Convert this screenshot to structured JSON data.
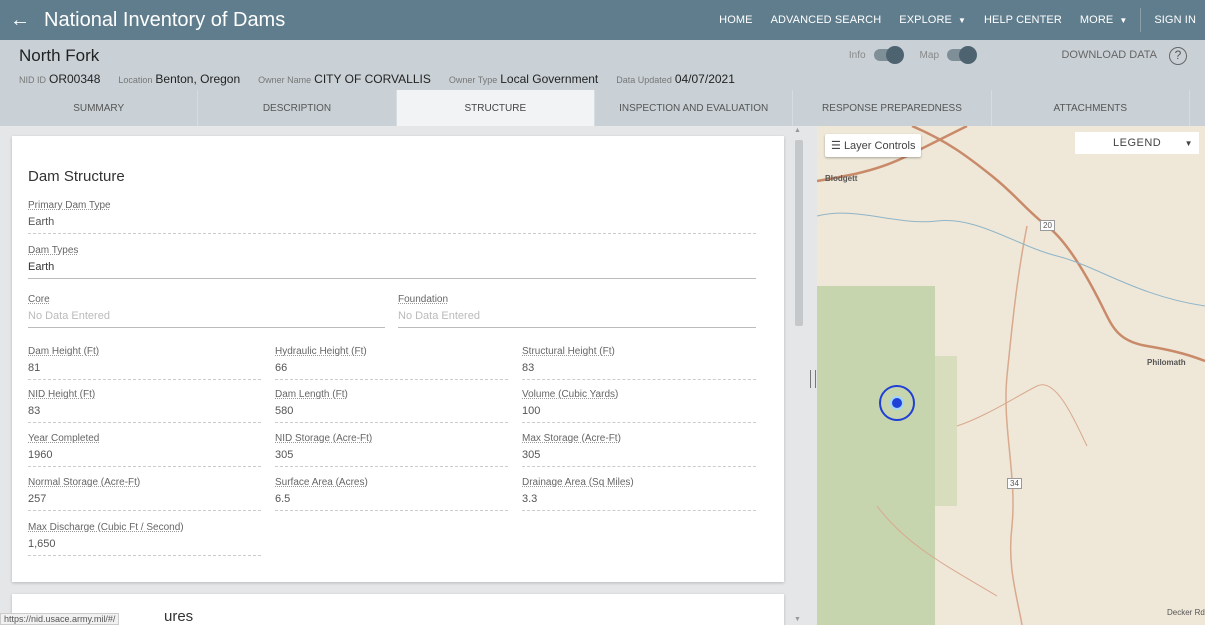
{
  "app": {
    "title": "National Inventory of Dams"
  },
  "nav": {
    "home": "HOME",
    "advanced_search": "ADVANCED SEARCH",
    "explore": "EXPLORE",
    "help_center": "HELP CENTER",
    "more": "MORE",
    "sign_in": "SIGN IN"
  },
  "header": {
    "dam_name": "North Fork",
    "nid_id_label": "NID ID",
    "nid_id": "OR00348",
    "location_label": "Location",
    "location": "Benton, Oregon",
    "owner_name_label": "Owner Name",
    "owner_name": "CITY OF CORVALLIS",
    "owner_type_label": "Owner Type",
    "owner_type": "Local Government",
    "data_updated_label": "Data Updated",
    "data_updated": "04/07/2021",
    "info_toggle": "Info",
    "map_toggle": "Map",
    "download": "DOWNLOAD DATA",
    "help": "?"
  },
  "tabs": [
    {
      "label": "SUMMARY"
    },
    {
      "label": "DESCRIPTION"
    },
    {
      "label": "STRUCTURE"
    },
    {
      "label": "INSPECTION AND EVALUATION"
    },
    {
      "label": "RESPONSE PREPAREDNESS"
    },
    {
      "label": "ATTACHMENTS"
    }
  ],
  "structure": {
    "title": "Dam Structure",
    "primary_dam_type": {
      "label": "Primary Dam Type",
      "value": "Earth"
    },
    "dam_types": {
      "label": "Dam Types",
      "value": "Earth"
    },
    "core": {
      "label": "Core",
      "value": "No Data Entered"
    },
    "foundation": {
      "label": "Foundation",
      "value": "No Data Entered"
    },
    "dam_height": {
      "label": "Dam Height (Ft)",
      "value": "81"
    },
    "hydraulic_height": {
      "label": "Hydraulic Height (Ft)",
      "value": "66"
    },
    "structural_height": {
      "label": "Structural Height (Ft)",
      "value": "83"
    },
    "nid_height": {
      "label": "NID Height (Ft)",
      "value": "83"
    },
    "dam_length": {
      "label": "Dam Length (Ft)",
      "value": "580"
    },
    "volume": {
      "label": "Volume (Cubic Yards)",
      "value": "100"
    },
    "year_completed": {
      "label": "Year Completed",
      "value": "1960"
    },
    "nid_storage": {
      "label": "NID Storage (Acre-Ft)",
      "value": "305"
    },
    "max_storage": {
      "label": "Max Storage (Acre-Ft)",
      "value": "305"
    },
    "normal_storage": {
      "label": "Normal Storage (Acre-Ft)",
      "value": "257"
    },
    "surface_area": {
      "label": "Surface Area (Acres)",
      "value": "6.5"
    },
    "drainage_area": {
      "label": "Drainage Area (Sq Miles)",
      "value": "3.3"
    },
    "max_discharge": {
      "label": "Max Discharge (Cubic Ft / Second)",
      "value": "1,650"
    }
  },
  "section2": {
    "title_partial": "ures"
  },
  "status_bar": {
    "url": "https://nid.usace.army.mil/#/"
  },
  "map": {
    "layer_controls": "Layer Controls",
    "legend": "LEGEND",
    "labels": {
      "blodgett": "Blodgett",
      "philomath": "Philomath",
      "hwy20": "20",
      "hwy34": "34",
      "decker": "Decker Rd"
    },
    "colors": {
      "road": "#c98a6a",
      "forest": "#b8cfa0",
      "marker": "#1f3fd6"
    }
  }
}
